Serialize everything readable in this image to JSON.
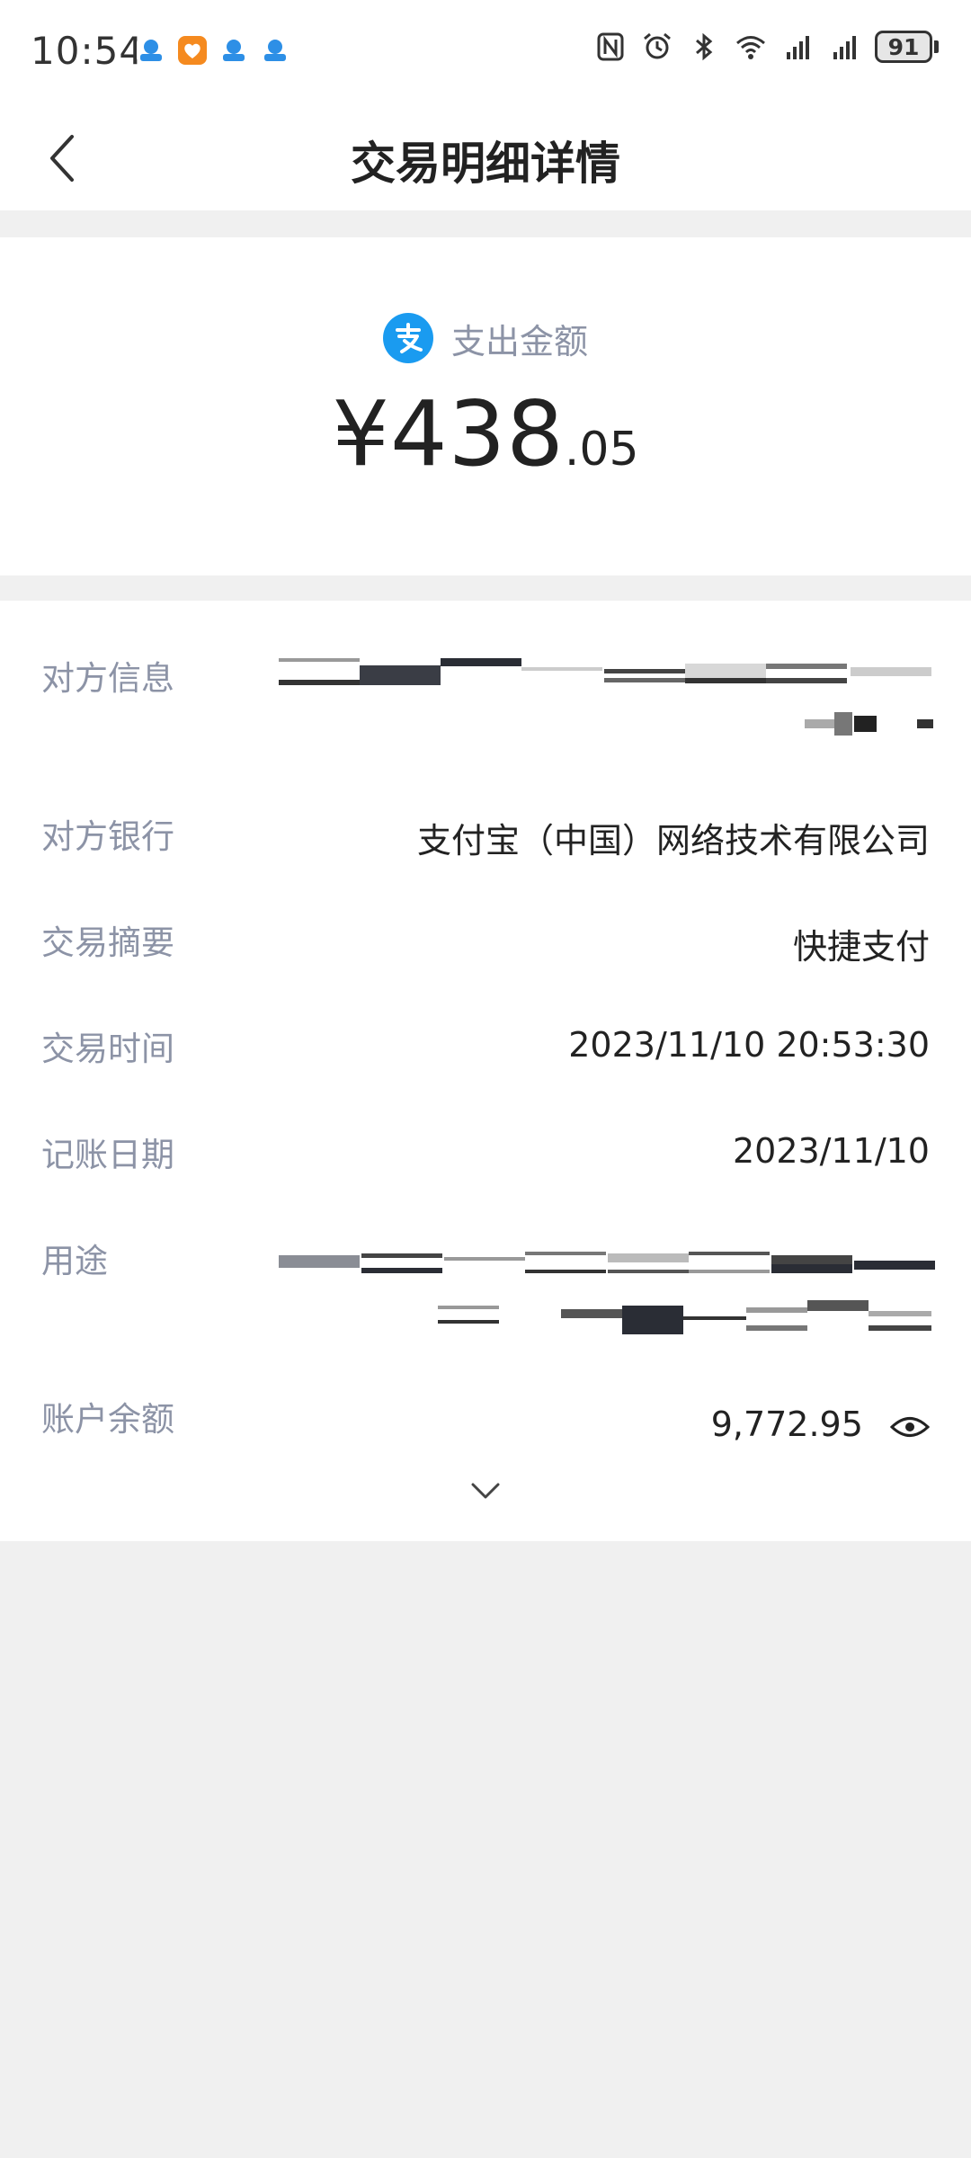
{
  "status_bar": {
    "time": "10:54",
    "battery": "91"
  },
  "nav": {
    "title": "交易明细详情"
  },
  "amount": {
    "label": "支出金额",
    "main": "¥438",
    "cents": ".05"
  },
  "details": {
    "counterparty_label": "对方信息",
    "bank_label": "对方银行",
    "bank_value": "支付宝（中国）网络技术有限公司",
    "summary_label": "交易摘要",
    "summary_value": "快捷支付",
    "time_label": "交易时间",
    "time_value": "2023/11/10 20:53:30",
    "date_label": "记账日期",
    "date_value": "2023/11/10",
    "purpose_label": "用途",
    "balance_label": "账户余额",
    "balance_value": "9,772.95"
  },
  "colors": {
    "accent_blue": "#1a9bf0",
    "label_gray": "#8c93a6",
    "page_bg": "#f0f0f0"
  }
}
